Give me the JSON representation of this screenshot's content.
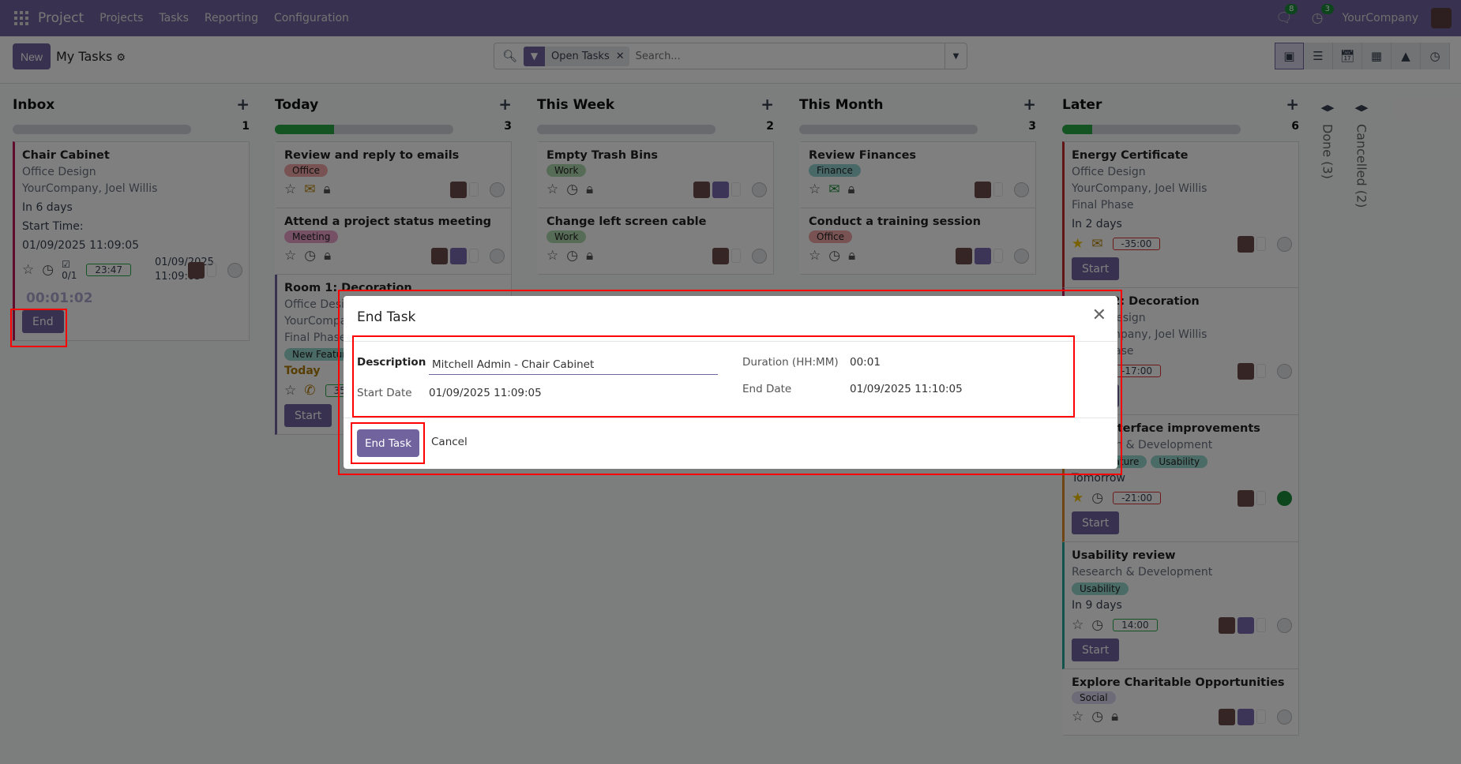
{
  "navbar": {
    "app": "Project",
    "menus": [
      "Projects",
      "Tasks",
      "Reporting",
      "Configuration"
    ],
    "messages_count": "8",
    "activities_count": "3",
    "company": "YourCompany"
  },
  "control": {
    "new_label": "New",
    "title": "My Tasks",
    "facet": "Open Tasks",
    "search_placeholder": "Search...",
    "views": [
      "kanban",
      "list",
      "calendar",
      "pivot",
      "graph",
      "activity"
    ]
  },
  "colors": {
    "primary": "#71639e",
    "success": "#28a745",
    "danger": "#dd3333"
  },
  "columns": [
    {
      "title": "Inbox",
      "count": "1",
      "progress": 0,
      "cards": [
        {
          "title": "Chair Cabinet",
          "lines": [
            "Office Design",
            "YourCompany, Joel Willis"
          ],
          "deadline": "In 6 days",
          "extra": [
            "Start Time:",
            "01/09/2025 11:09:05"
          ],
          "tags": [],
          "star": false,
          "icons": [
            "clock"
          ],
          "subtasks": "0/1",
          "timer": "23:47",
          "timer_neg": false,
          "date": "01/09/2025",
          "time": "11:09:05",
          "running": "00:01:02",
          "button": "End",
          "border": "#c2185b",
          "avatars": 1,
          "state": "normal"
        }
      ]
    },
    {
      "title": "Today",
      "count": "3",
      "progress": 33,
      "cards": [
        {
          "title": "Review and reply to emails",
          "lines": [],
          "tags": [
            {
              "l": "Office",
              "c": "#f3a6a6"
            }
          ],
          "star": false,
          "icons": [
            "mail",
            "lock"
          ],
          "avatars": 1,
          "state": "normal"
        },
        {
          "title": "Attend a project status meeting",
          "lines": [],
          "tags": [
            {
              "l": "Meeting",
              "c": "#eca3cb"
            }
          ],
          "star": false,
          "icons": [
            "clock",
            "lock"
          ],
          "avatars": 2,
          "state": "normal"
        },
        {
          "title": "Room 1: Decoration",
          "lines": [
            "Office Design",
            "YourCompany, Joel Willis",
            "Final Phase"
          ],
          "tags": [
            {
              "l": "New Feature",
              "c": "#97d6cc"
            }
          ],
          "deadline": "Today",
          "deadline_color": "#b07a00",
          "star": false,
          "icons": [
            "phone"
          ],
          "timer": "35:00",
          "timer_neg": false,
          "button": "Start",
          "border": "#71639e",
          "avatars": 1,
          "state": "normal"
        }
      ]
    },
    {
      "title": "This Week",
      "count": "2",
      "progress": 0,
      "cards": [
        {
          "title": "Empty Trash Bins",
          "lines": [],
          "tags": [
            {
              "l": "Work",
              "c": "#afd9af"
            }
          ],
          "star": false,
          "icons": [
            "clock",
            "lock"
          ],
          "avatars": 2,
          "state": "normal"
        },
        {
          "title": "Change left screen cable",
          "lines": [],
          "tags": [
            {
              "l": "Work",
              "c": "#afd9af"
            }
          ],
          "star": false,
          "icons": [
            "clock",
            "lock"
          ],
          "avatars": 1,
          "state": "normal"
        }
      ]
    },
    {
      "title": "This Month",
      "count": "3",
      "progress": 0,
      "cards": [
        {
          "title": "Review Finances",
          "lines": [],
          "tags": [
            {
              "l": "Finance",
              "c": "#93d2d2"
            }
          ],
          "star": false,
          "icons": [
            "mail-green",
            "lock"
          ],
          "avatars": 1,
          "state": "normal"
        },
        {
          "title": "Conduct a training session",
          "lines": [],
          "tags": [
            {
              "l": "Office",
              "c": "#f3a6a6"
            }
          ],
          "star": false,
          "icons": [
            "clock",
            "lock"
          ],
          "avatars": 2,
          "state": "normal"
        }
      ]
    },
    {
      "title": "Later",
      "count": "6",
      "progress": 17,
      "cards": [
        {
          "title": "Energy Certificate",
          "lines": [
            "Office Design",
            "YourCompany, Joel Willis",
            "Final Phase"
          ],
          "deadline": "In 2 days",
          "tags": [],
          "star": true,
          "icons": [
            "mail"
          ],
          "timer": "-35:00",
          "timer_neg": true,
          "button": "Start",
          "border": "#c62828",
          "avatars": 1,
          "state": "normal"
        },
        {
          "title": "Room 2: Decoration",
          "lines": [
            "Office Design",
            "YourCompany, Joel Willis",
            "Final Phase"
          ],
          "deadline": "",
          "tags": [],
          "star": false,
          "icons": [
            "clock"
          ],
          "timer": "-17:00",
          "timer_neg": true,
          "button": "Start",
          "border": "#c2185b",
          "avatars": 1,
          "state": "normal"
        },
        {
          "title": "User interface improvements",
          "lines": [
            "Research & Development"
          ],
          "tags": [
            {
              "l": "New Feature",
              "c": "#97d6cc"
            },
            {
              "l": "Usability",
              "c": "#97d6cc"
            }
          ],
          "deadline": "Tomorrow",
          "star": true,
          "icons": [
            "clock"
          ],
          "timer": "-21:00",
          "timer_neg": true,
          "button": "Start",
          "border": "#e08a2a",
          "avatars": 1,
          "state": "done"
        },
        {
          "title": "Usability review",
          "lines": [
            "Research & Development"
          ],
          "tags": [
            {
              "l": "Usability",
              "c": "#97d6cc"
            }
          ],
          "deadline": "In 9 days",
          "star": false,
          "icons": [
            "clock"
          ],
          "timer": "14:00",
          "timer_neg": false,
          "button": "Start",
          "border": "#26a69a",
          "avatars": 2,
          "state": "normal"
        },
        {
          "title": "Explore Charitable Opportunities",
          "lines": [],
          "tags": [
            {
              "l": "Social",
              "c": "#ddd6f0"
            }
          ],
          "star": false,
          "icons": [
            "clock",
            "lock"
          ],
          "avatars": 2,
          "state": "normal"
        }
      ]
    }
  ],
  "folded": [
    {
      "label": "Done (3)"
    },
    {
      "label": "Cancelled (2)"
    }
  ],
  "modal": {
    "title": "End Task",
    "description_label": "Description",
    "description_value": "Mitchell Admin - Chair Cabinet",
    "start_label": "Start Date",
    "start_value": "01/09/2025 11:09:05",
    "duration_label": "Duration (HH:MM)",
    "duration_value": "00:01",
    "end_label": "End Date",
    "end_value": "01/09/2025 11:10:05",
    "confirm_label": "End Task",
    "cancel_label": "Cancel"
  }
}
